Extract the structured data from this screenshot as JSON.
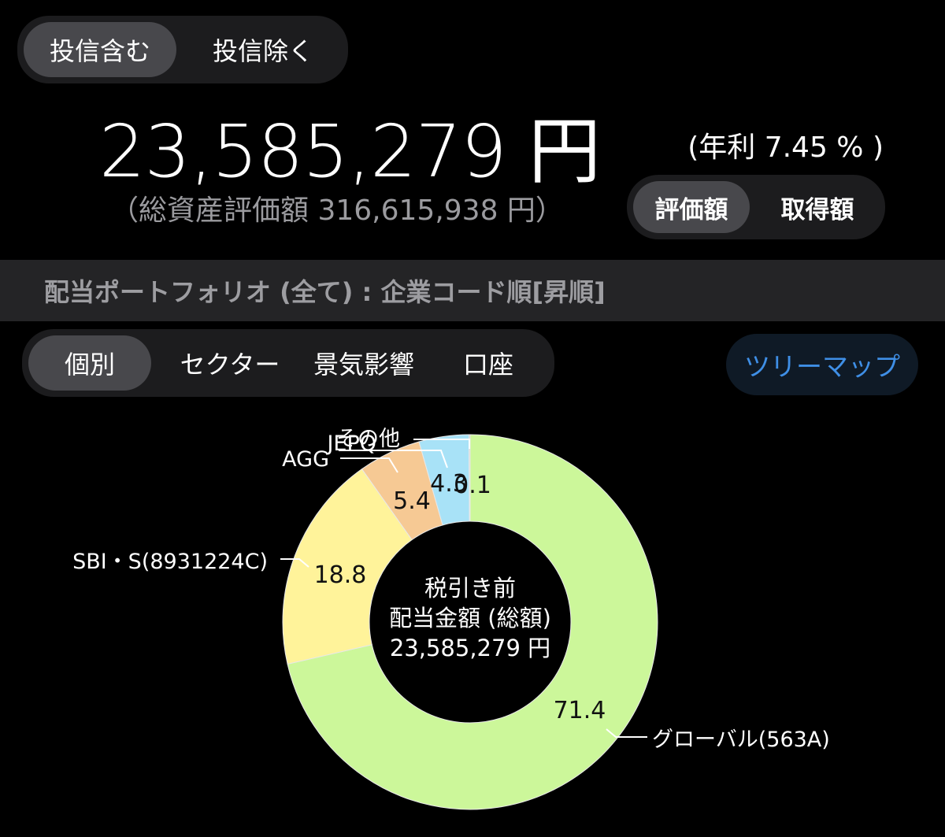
{
  "fund_toggle": {
    "include": "投信含む",
    "exclude": "投信除く"
  },
  "total_amount": "23,585,279 円",
  "annual_rate": "(年利 7.45 % )",
  "total_assets": "（総資産評価額 316,615,938 円）",
  "value_toggle": {
    "valuation": "評価額",
    "acquisition": "取得額"
  },
  "section_title": "配当ポートフォリオ (全て) : 企業コード順[昇順]",
  "view_tabs": {
    "individual": "個別",
    "sector": "セクター",
    "economy": "景気影響",
    "account": "口座"
  },
  "treemap_label": "ツリーマップ",
  "colors": {
    "accent_blue": "#3f8fe6",
    "active_segment": "#48484c",
    "segment_bg": "#1c1c1e"
  },
  "chart_data": {
    "type": "pie",
    "style": "donut",
    "unit": "%",
    "center_label": [
      "税引き前",
      "配当金額 (総額)",
      "23,585,279 円"
    ],
    "slices": [
      {
        "name": "グローバル(563A)",
        "value": 71.4,
        "value_label": "71.4",
        "color": "#ccf79a"
      },
      {
        "name": "SBI・S(8931224C)",
        "value": 18.8,
        "value_label": "18.8",
        "color": "#fff39a"
      },
      {
        "name": "AGG",
        "value": 5.4,
        "value_label": "5.4",
        "color": "#f6c994"
      },
      {
        "name": "JEPQ",
        "value": 4.3,
        "value_label": "4.3",
        "color": "#a8e2f7"
      },
      {
        "name": "その他",
        "value": 0.1,
        "value_label": "0.1",
        "color": "#cccccc"
      }
    ]
  }
}
